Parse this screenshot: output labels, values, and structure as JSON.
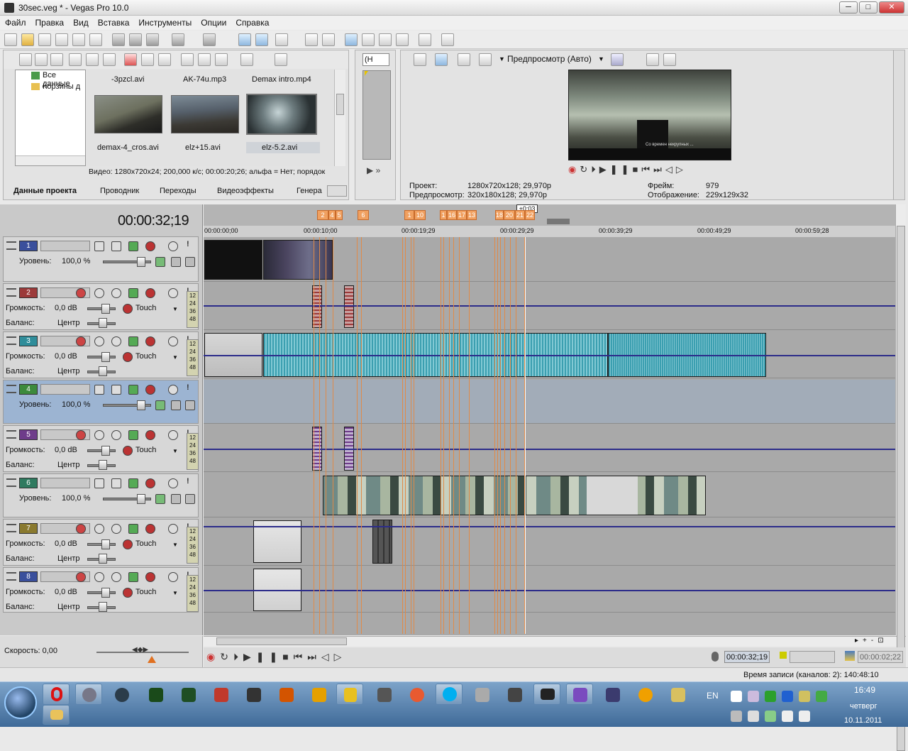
{
  "window": {
    "title": "30sec.veg * - Vegas Pro 10.0",
    "min_glyph": "─",
    "max_glyph": "□",
    "close_glyph": "✕",
    "accent": "#d04040"
  },
  "menu": [
    "Файл",
    "Правка",
    "Вид",
    "Вставка",
    "Инструменты",
    "Опции",
    "Справка"
  ],
  "explorer": {
    "tree": [
      {
        "label": "Все данные",
        "icon": "media-icon"
      },
      {
        "label": "Корзины д",
        "icon": "folder-icon"
      }
    ],
    "media_top": [
      "-3pzcl.avi",
      "AK-74u.mp3",
      "Demax intro.mp4"
    ],
    "media_bottom": [
      "demax-4_cros.avi",
      "elz+15.avi",
      "elz-5.2.avi"
    ],
    "info": "Видео: 1280x720x24; 200,000 к/с; 00:00:20;26; альфа = Нет; порядок",
    "tabs": [
      "Данные проекта",
      "Проводник",
      "Переходы",
      "Видеоэффекты",
      "Генера"
    ]
  },
  "trimmer": {
    "dropdown": "(Н"
  },
  "preview": {
    "mode": "Предпросмотр (Авто)",
    "labels": {
      "project": "Проект:",
      "preview": "Предпросмотр:",
      "frame": "Фрейм:",
      "display": "Отображение:"
    },
    "values": {
      "project": "1280x720x128; 29,970p",
      "preview": "320x180x128; 29,970p",
      "frame": "979",
      "display": "229x129x32"
    },
    "subtitle_text": "Со времен некрупных ..."
  },
  "timeline": {
    "timecode": "00:00:32;19",
    "ruler": [
      "00:00:00;00",
      "00:00:10;00",
      "00:00:19;29",
      "00:00:29;29",
      "00:00:39;29",
      "00:00:49;29",
      "00:00:59;28"
    ],
    "cursor_label": "+0:03",
    "markers": [
      "2",
      "4",
      "5",
      "6",
      "1",
      "10",
      "1",
      "16",
      "17",
      "13",
      "18",
      "20",
      "21",
      "22"
    ]
  },
  "tracks": [
    {
      "num": "1",
      "kind": "video",
      "color": "#3a4f9c",
      "l1": "Уровень:",
      "v1": "100,0 %"
    },
    {
      "num": "2",
      "kind": "audio",
      "color": "#9c3a3a",
      "l1": "Громкость:",
      "v1": "0,0 dB",
      "touch": "Touch",
      "l2": "Баланс:",
      "v2": "Центр"
    },
    {
      "num": "3",
      "kind": "audio",
      "color": "#2f8d9a",
      "l1": "Громкость:",
      "v1": "0,0 dB",
      "touch": "Touch",
      "l2": "Баланс:",
      "v2": "Центр"
    },
    {
      "num": "4",
      "kind": "video",
      "color": "#3c8a3c",
      "l1": "Уровень:",
      "v1": "100,0 %"
    },
    {
      "num": "5",
      "kind": "audio",
      "color": "#6e3c8a",
      "l1": "Громкость:",
      "v1": "0,0 dB",
      "touch": "Touch",
      "l2": "Баланс:",
      "v2": "Центр"
    },
    {
      "num": "6",
      "kind": "video",
      "color": "#2f7a5f",
      "l1": "Уровень:",
      "v1": "100,0 %"
    },
    {
      "num": "7",
      "kind": "audio",
      "color": "#8a7a2f",
      "l1": "Громкость:",
      "v1": "0,0 dB",
      "touch": "Touch",
      "l2": "Баланс:",
      "v2": "Центр"
    },
    {
      "num": "8",
      "kind": "audio",
      "color": "#3a4f9c",
      "l1": "Громкость:",
      "v1": "0,0 dB",
      "touch": "Touch",
      "l2": "Баланс:",
      "v2": "Центр"
    }
  ],
  "meter_labels": [
    "12",
    "24",
    "36",
    "48"
  ],
  "bottom": {
    "speed": "Скорость: 0,00",
    "time": "00:00:32;19",
    "len": "00:00:02;22",
    "record": "Время записи (каналов: 2): 140:48:10"
  },
  "taskbar": {
    "lang": "EN",
    "time": "16:49",
    "day": "четверг",
    "date": "10.11.2011"
  }
}
